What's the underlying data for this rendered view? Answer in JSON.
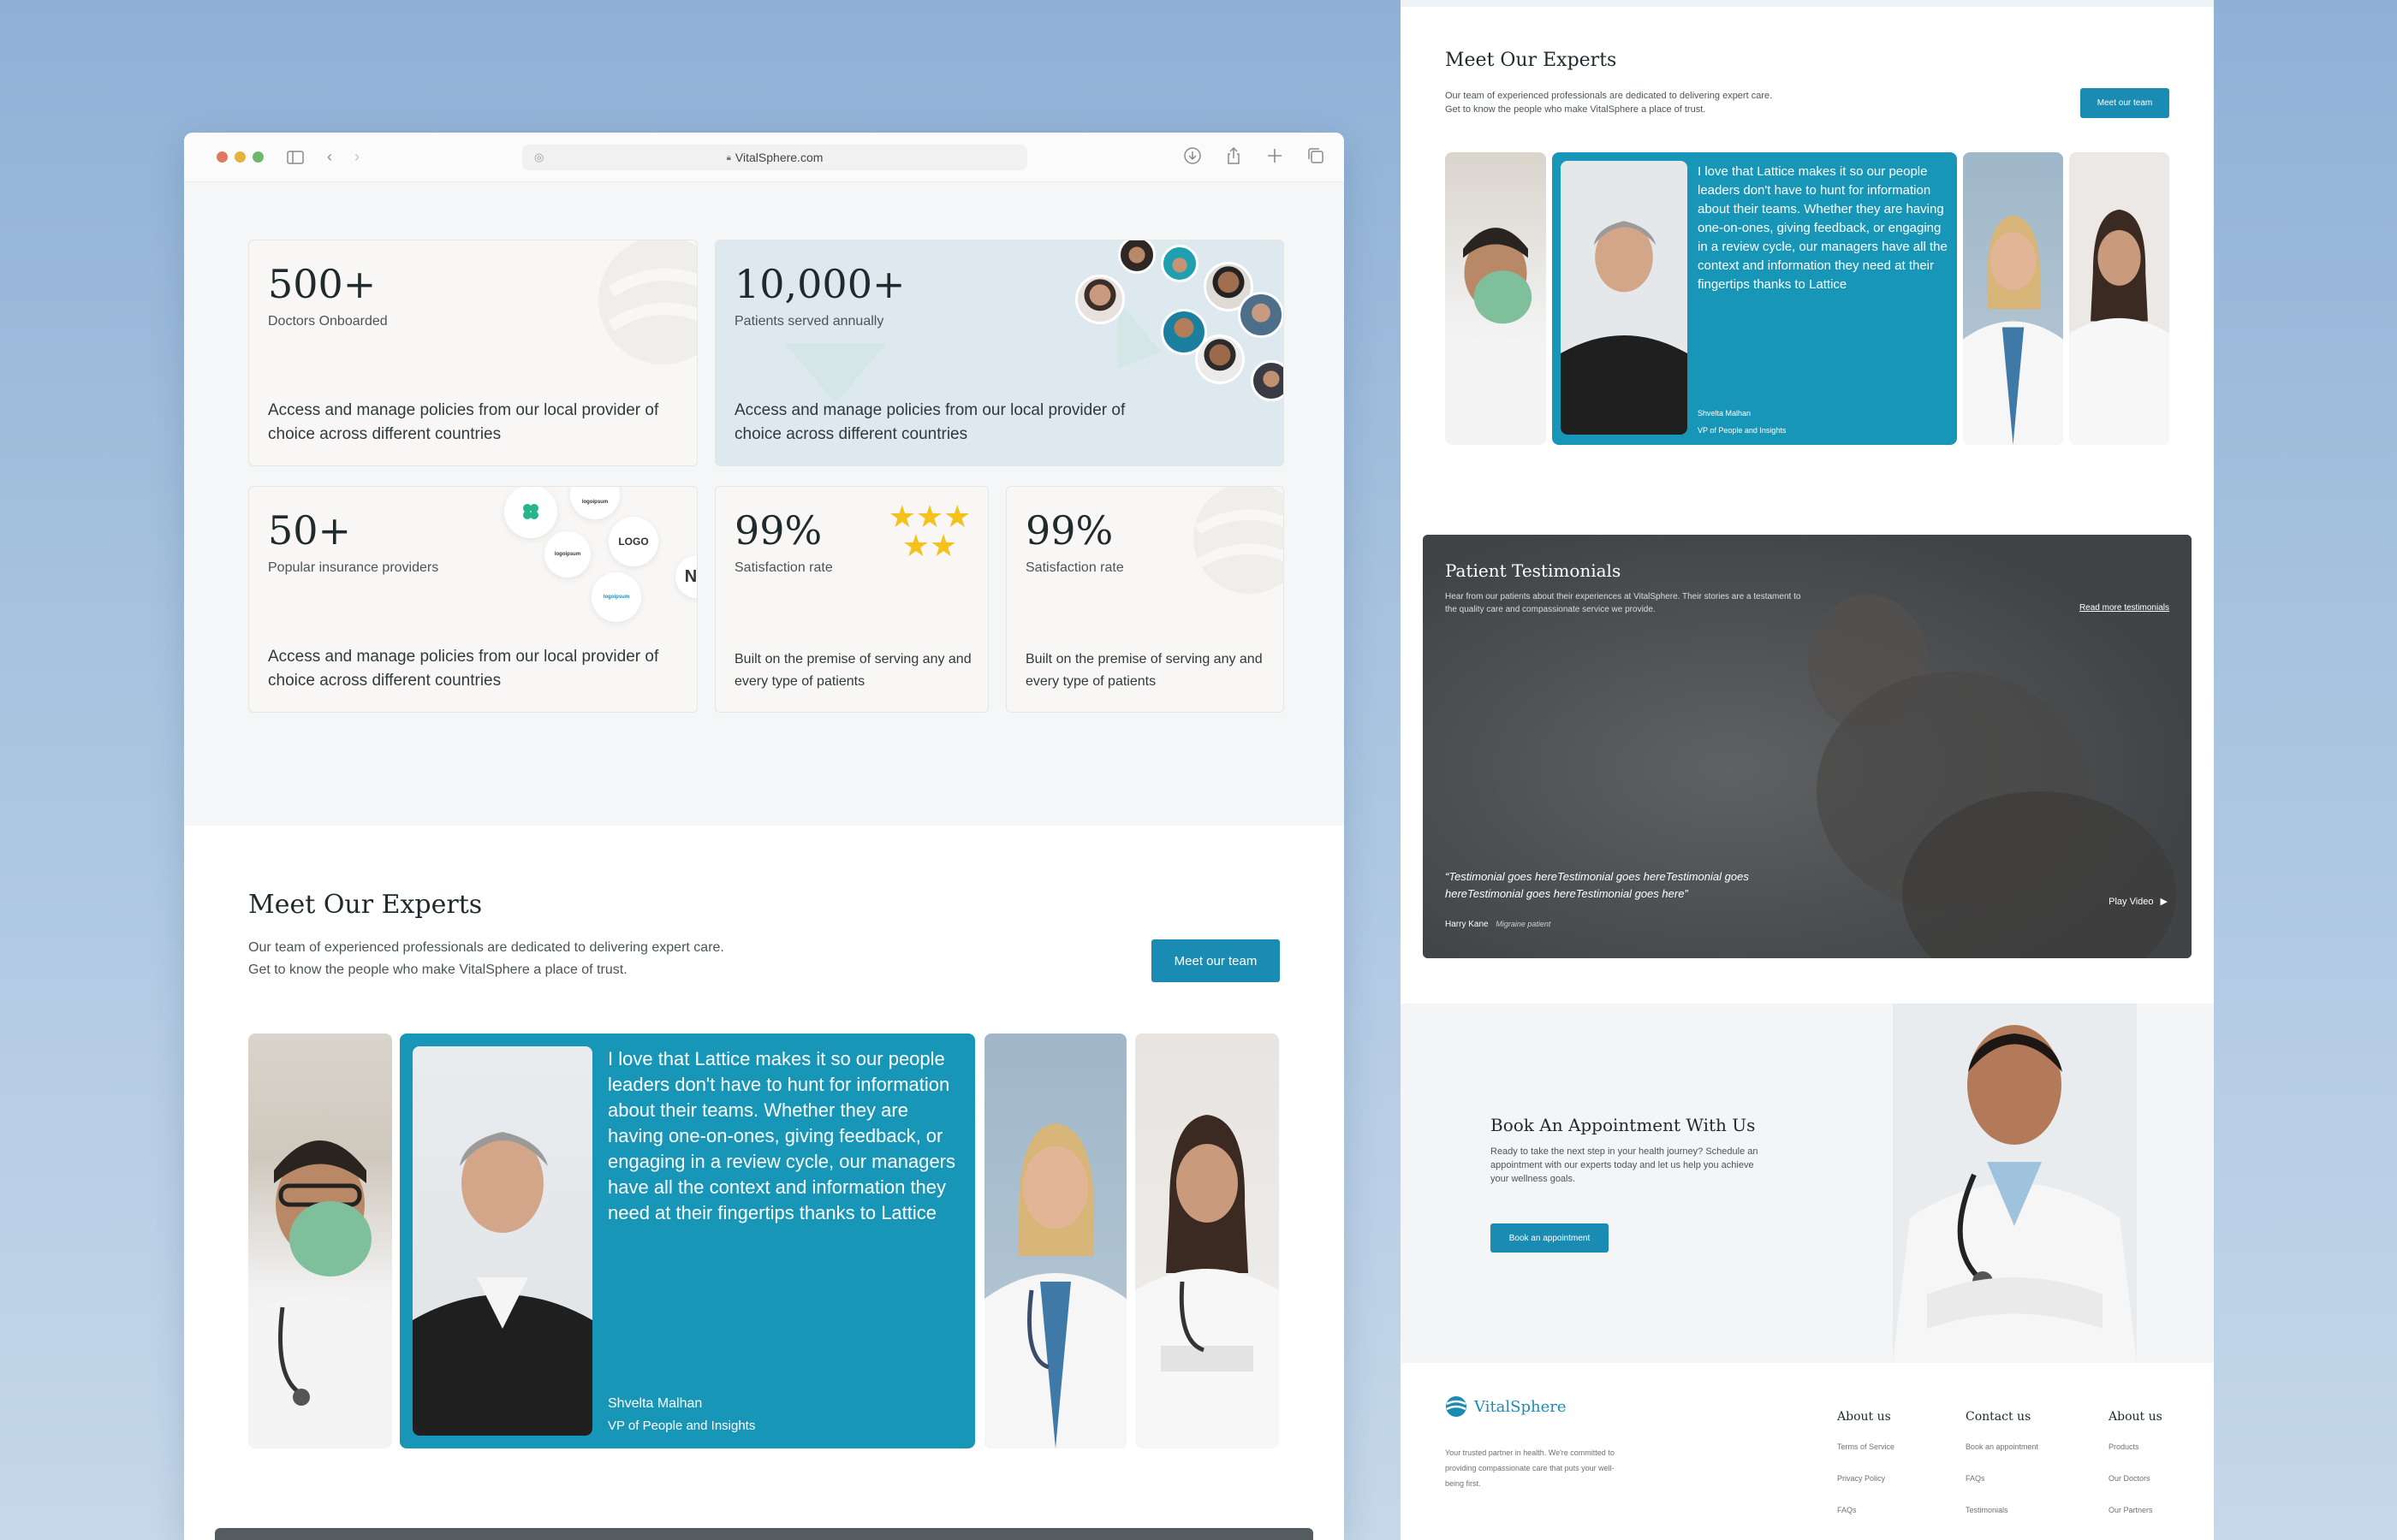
{
  "browser": {
    "url": "VitalSphere.com",
    "traffic_colors": [
      "#e0795f",
      "#e5b43f",
      "#6cb86a"
    ]
  },
  "stats": {
    "cards": [
      {
        "number": "500+",
        "label": "Doctors Onboarded",
        "description": "Access and manage policies from our local provider of choice across different countries"
      },
      {
        "number": "10,000+",
        "label": "Patients served annually",
        "description": "Access and manage policies from our local provider of choice across different countries"
      },
      {
        "number": "50+",
        "label": "Popular insurance providers",
        "description": "Access and manage policies from our local provider of choice across different countries"
      },
      {
        "number": "99%",
        "label": "Satisfaction rate",
        "description": "Built on the premise of serving any and every type of patients",
        "stars": 5
      },
      {
        "number": "99%",
        "label": "Satisfaction rate",
        "description": "Built on the premise of serving any and every type of patients"
      }
    ],
    "insurance_logos": [
      "logoipsum",
      "LOGO",
      "logoipsum",
      "logoipsum",
      "N"
    ]
  },
  "experts": {
    "title": "Meet Our Experts",
    "text": "Our team of experienced professionals are dedicated to delivering expert care. Get to know the people who make VitalSphere a place of trust.",
    "button": "Meet our team",
    "testimonial": {
      "quote": "I love that Lattice makes it so our people leaders don't have to hunt for information about their teams. Whether they are having one-on-ones, giving feedback, or engaging in a review cycle, our managers have all the context and information they need at their fingertips thanks to Lattice",
      "name": "Shvelta Malhan",
      "role": "VP of People and Insights"
    }
  },
  "patient_testimonials": {
    "title": "Patient Testimonials",
    "text": "Hear from our patients about their experiences at VitalSphere. Their stories are a testament to the quality care and compassionate service we provide.",
    "read_more": "Read more testimonials",
    "quote": "“Testimonial goes hereTestimonial goes hereTestimonial goes hereTestimonial goes hereTestimonial goes here”",
    "author": "Harry Kane",
    "author_note": "Migraine patient",
    "play_label": "Play Video"
  },
  "booking": {
    "title": "Book An Appointment With Us",
    "text": "Ready to take the next step in your health journey? Schedule an appointment with our experts today and let us help you achieve your wellness goals.",
    "button": "Book an appointment"
  },
  "footer": {
    "brand": "VitalSphere",
    "tagline": "Your trusted partner in health. We're committed to providing compassionate care that puts your well-being first.",
    "columns": [
      {
        "title": "About us",
        "links": [
          "Terms of Service",
          "Privacy Policy",
          "FAQs"
        ]
      },
      {
        "title": "Contact us",
        "links": [
          "Book an appointment",
          "FAQs",
          "Testimonials"
        ]
      },
      {
        "title": "About us",
        "links": [
          "Products",
          "Our Doctors",
          "Our Partners"
        ]
      }
    ]
  },
  "colors": {
    "accent": "#1a8cb3",
    "testimonial_card": "#1796b8",
    "star": "#f4c21b"
  }
}
